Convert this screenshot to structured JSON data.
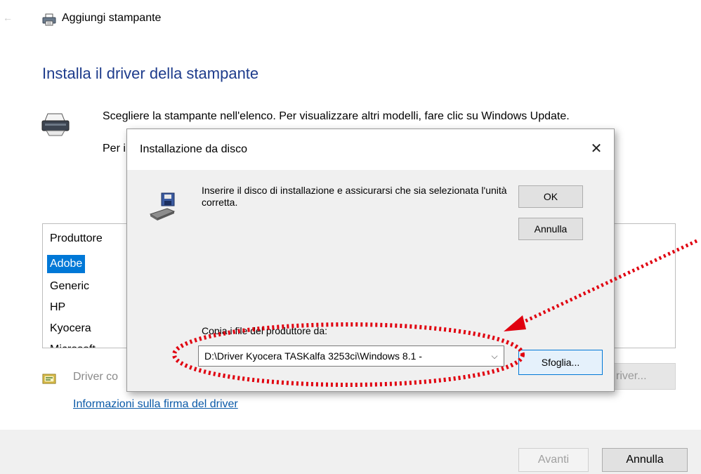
{
  "window": {
    "title": "Aggiungi stampante",
    "back_icon": "arrow-left-icon",
    "printer_icon": "printer-icon"
  },
  "wizard": {
    "heading": "Installa il driver della stampante",
    "instruction_line1": "Scegliere la stampante nell'elenco. Per visualizzare altri modelli, fare clic su Windows Update.",
    "instruction_line2": "Per i",
    "manufacturer_header": "Produttore",
    "manufacturers": [
      "Adobe",
      "Generic",
      "HP",
      "Kyocera",
      "Microsoft"
    ],
    "selected_manufacturer": "Adobe",
    "cert_text": "Driver co",
    "windows_update_button": "river...",
    "signature_link": "Informazioni sulla firma del driver",
    "next_button": "Avanti",
    "cancel_button": "Annulla"
  },
  "disk_dialog": {
    "title": "Installazione da disco",
    "close_label": "✕",
    "message": "Inserire il disco di installazione e assicurarsi che sia selezionata l'unità corretta.",
    "ok_button": "OK",
    "cancel_button": "Annulla",
    "copy_label": "Copia i file del produttore da:",
    "path_value": "D:\\Driver Kyocera TASKalfa 3253ci\\Windows 8.1 -",
    "browse_button": "Sfoglia..."
  },
  "colors": {
    "heading": "#1e3c8c",
    "selection": "#0078d7",
    "link": "#0b5aa8",
    "annotation": "#e0000f"
  }
}
